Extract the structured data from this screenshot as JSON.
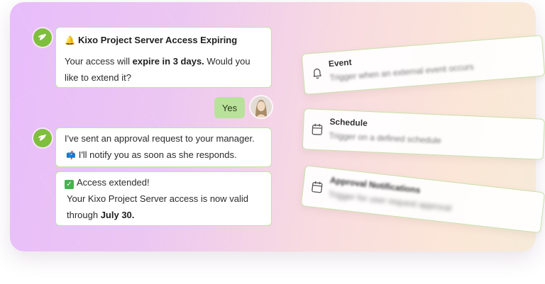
{
  "chat": {
    "messages": [
      {
        "title": "Kixo Project Server Access Expiring",
        "text_before": "Your access will ",
        "bold": "expire in 3 days.",
        "text_after": " Would you like to extend it?"
      },
      {
        "line1": "I've sent an approval request to your manager.",
        "line2": "I'll notify you as soon as she responds."
      },
      {
        "title": "Access extended!",
        "text_before": "Your Kixo Project Server access is now valid through ",
        "bold": "July 30."
      }
    ],
    "user_reply": "Yes"
  },
  "triggers": [
    {
      "title": "Event",
      "description": "Trigger when an external event occurs",
      "icon": "bell-icon"
    },
    {
      "title": "Schedule",
      "description": "Trigger on a defined schedule",
      "icon": "calendar-icon"
    },
    {
      "title": "Approval Notifications",
      "description": "Trigger for user request approval",
      "icon": "calendar-icon"
    }
  ],
  "colors": {
    "accent_green": "#7fbf3d",
    "bubble_border": "#bfe3a0",
    "reply_bubble": "#b8e29a"
  }
}
